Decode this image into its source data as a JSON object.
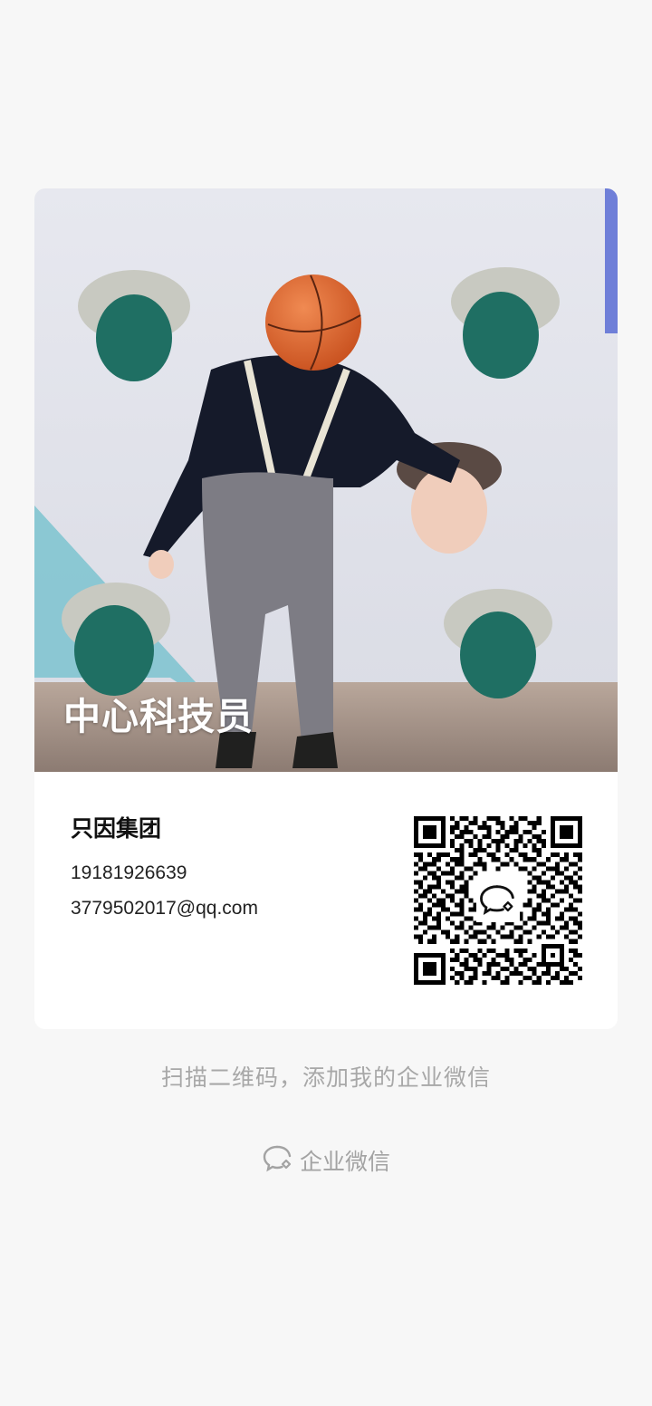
{
  "card": {
    "cover_title": "中心科技员",
    "company": "只因集团",
    "phone": "19181926639",
    "email": "3779502017@qq.com"
  },
  "hint": "扫描二维码，添加我的企业微信",
  "footer": {
    "label": "企业微信",
    "icon": "wecom-chat-icon"
  },
  "colors": {
    "page_background": "#f7f7f7",
    "card_background": "#ffffff",
    "hint_text": "#a8a8a8"
  }
}
